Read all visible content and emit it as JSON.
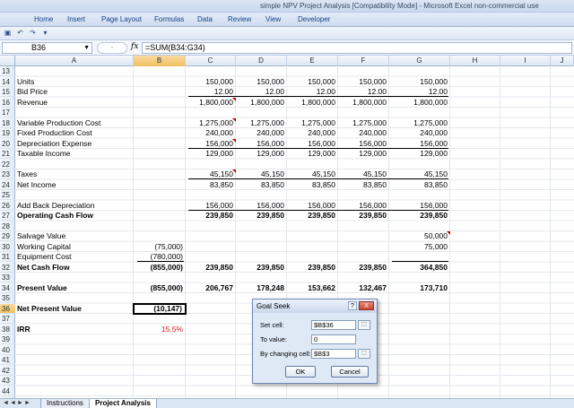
{
  "window": {
    "title": "simple NPV Project Analysis [Compatibility Mode] - Microsoft Excel non-commercial use"
  },
  "ribbon": {
    "tabs": [
      "Home",
      "Insert",
      "Page Layout",
      "Formulas",
      "Data",
      "Review",
      "View",
      "Developer"
    ]
  },
  "formula_bar": {
    "name_box": "B36",
    "fx": "fx",
    "formula": "=SUM(B34:G34)"
  },
  "columns": [
    "A",
    "B",
    "C",
    "D",
    "E",
    "F",
    "G",
    "H",
    "I",
    "J"
  ],
  "rows": [
    "13",
    "14",
    "15",
    "16",
    "17",
    "18",
    "19",
    "20",
    "21",
    "22",
    "23",
    "24",
    "25",
    "26",
    "27",
    "28",
    "29",
    "30",
    "31",
    "32",
    "33",
    "34",
    "35",
    "36",
    "37",
    "38",
    "39",
    "40",
    "41",
    "42",
    "43",
    "44"
  ],
  "sheet": {
    "r14": {
      "a": "Units",
      "c": "150,000",
      "d": "150,000",
      "e": "150,000",
      "f": "150,000",
      "g": "150,000"
    },
    "r15": {
      "a": "Bid Price",
      "c": "12.00",
      "d": "12.00",
      "e": "12.00",
      "f": "12.00",
      "g": "12.00"
    },
    "r16": {
      "a": "Revenue",
      "c": "1,800,000",
      "d": "1,800,000",
      "e": "1,800,000",
      "f": "1,800,000",
      "g": "1,800,000"
    },
    "r18": {
      "a": "Variable Production Cost",
      "c": "1,275,000",
      "d": "1,275,000",
      "e": "1,275,000",
      "f": "1,275,000",
      "g": "1,275,000"
    },
    "r19": {
      "a": "Fixed Production Cost",
      "c": "240,000",
      "d": "240,000",
      "e": "240,000",
      "f": "240,000",
      "g": "240,000"
    },
    "r20": {
      "a": "Depreciation Expense",
      "c": "156,000",
      "d": "156,000",
      "e": "156,000",
      "f": "156,000",
      "g": "156,000"
    },
    "r21": {
      "a": "Taxable Income",
      "c": "129,000",
      "d": "129,000",
      "e": "129,000",
      "f": "129,000",
      "g": "129,000"
    },
    "r23": {
      "a": "Taxes",
      "c": "45,150",
      "d": "45,150",
      "e": "45,150",
      "f": "45,150",
      "g": "45,150"
    },
    "r24": {
      "a": "Net Income",
      "c": "83,850",
      "d": "83,850",
      "e": "83,850",
      "f": "83,850",
      "g": "83,850"
    },
    "r26": {
      "a": "Add Back Depreciation",
      "c": "156,000",
      "d": "156,000",
      "e": "156,000",
      "f": "156,000",
      "g": "156,000"
    },
    "r27": {
      "a": "Operating Cash Flow",
      "c": "239,850",
      "d": "239,850",
      "e": "239,850",
      "f": "239,850",
      "g": "239,850"
    },
    "r29": {
      "a": "Salvage Value",
      "g": "50,000"
    },
    "r30": {
      "a": "Working Capital",
      "b": "(75,000)",
      "g": "75,000"
    },
    "r31": {
      "a": "Equipment Cost",
      "b": "(780,000)"
    },
    "r32": {
      "a": "Net Cash Flow",
      "b": "(855,000)",
      "c": "239,850",
      "d": "239,850",
      "e": "239,850",
      "f": "239,850",
      "g": "364,850"
    },
    "r34": {
      "a": "Present Value",
      "b": "(855,000)",
      "c": "206,767",
      "d": "178,248",
      "e": "153,662",
      "f": "132,467",
      "g": "173,710"
    },
    "r36": {
      "a": "Net Present Value",
      "b": "(10,147)"
    },
    "r38": {
      "a": "IRR",
      "b": "15.5%"
    }
  },
  "sheet_tabs": {
    "tab1": "Instructions",
    "tab2": "Project Analysis"
  },
  "goal_seek": {
    "title": "Goal Seek",
    "help": "?",
    "close": "X",
    "set_cell_label": "Set cell:",
    "set_cell_value": "$B$36",
    "to_value_label": "To value:",
    "to_value_value": "0",
    "changing_label": "By changing cell:",
    "changing_value": "$B$3",
    "ok": "OK",
    "cancel": "Cancel"
  },
  "colors": {
    "accent": "#15428b",
    "red_text": "#d01a1a",
    "selected_header": "#f1c15f"
  }
}
